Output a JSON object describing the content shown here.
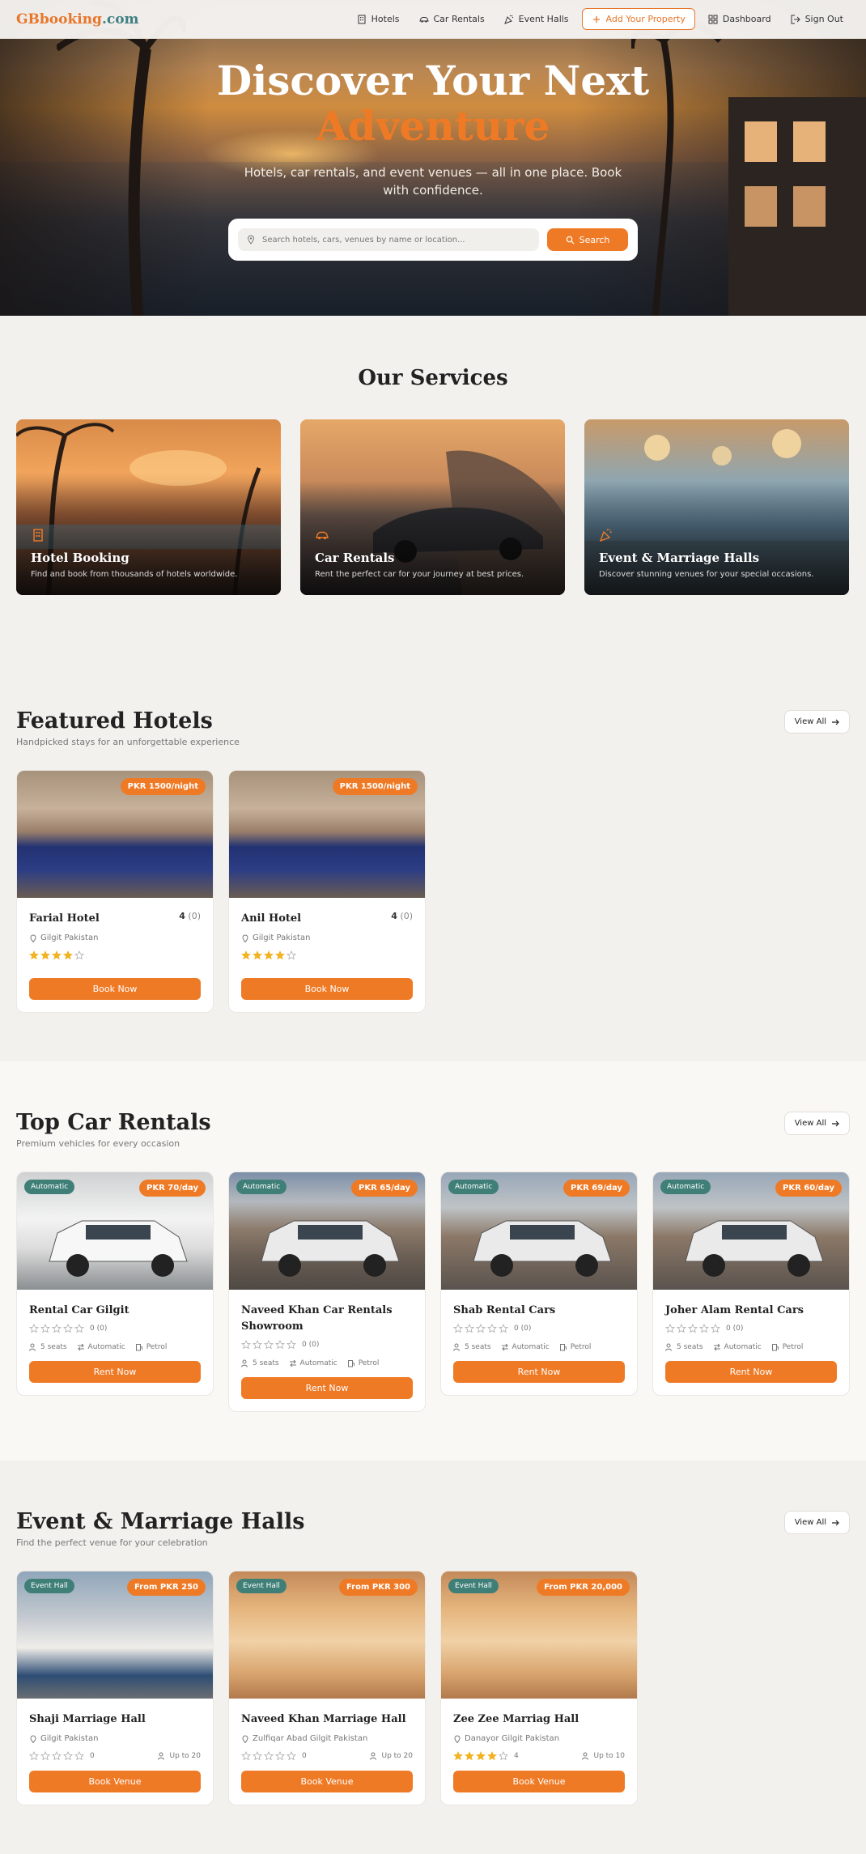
{
  "nav": {
    "logo_part1": "GBbooking",
    "logo_part2": ".com",
    "hotels": "Hotels",
    "car_rentals": "Car Rentals",
    "event_halls": "Event Halls",
    "add_property": "Add Your Property",
    "dashboard": "Dashboard",
    "sign_out": "Sign Out"
  },
  "hero": {
    "title_line1": "Discover Your Next",
    "title_line2": "Adventure",
    "subtitle": "Hotels, car rentals, and event venues — all in one place. Book with confidence.",
    "search_placeholder": "Search hotels, cars, venues by name or location...",
    "search_button": "Search"
  },
  "services": {
    "title": "Our Services",
    "items": [
      {
        "title": "Hotel Booking",
        "desc": "Find and book from thousands of hotels worldwide.",
        "icon": "building-icon"
      },
      {
        "title": "Car Rentals",
        "desc": "Rent the perfect car for your journey at best prices.",
        "icon": "car-icon"
      },
      {
        "title": "Event & Marriage Halls",
        "desc": "Discover stunning venues for your special occasions.",
        "icon": "party-icon"
      }
    ]
  },
  "hotels": {
    "title": "Featured Hotels",
    "subtitle": "Handpicked stays for an unforgettable experience",
    "view_all": "View All",
    "items": [
      {
        "name": "Farial Hotel",
        "price": "PKR 1500/night",
        "rating": "4",
        "reviews": "(0)",
        "location": "Gilgit Pakistan",
        "stars": 4,
        "button": "Book Now"
      },
      {
        "name": "Anil Hotel",
        "price": "PKR 1500/night",
        "rating": "4",
        "reviews": "(0)",
        "location": "Gilgit Pakistan",
        "stars": 4,
        "button": "Book Now"
      }
    ]
  },
  "cars": {
    "title": "Top Car Rentals",
    "subtitle": "Premium vehicles for every occasion",
    "view_all": "View All",
    "items": [
      {
        "name": "Rental Car Gilgit",
        "tag": "Automatic",
        "price": "PKR 70/day",
        "reviews": "0 (0)",
        "seats": "5 seats",
        "trans": "Automatic",
        "fuel": "Petrol",
        "button": "Rent Now"
      },
      {
        "name": "Naveed Khan Car Rentals Showroom",
        "tag": "Automatic",
        "price": "PKR 65/day",
        "reviews": "0 (0)",
        "seats": "5 seats",
        "trans": "Automatic",
        "fuel": "Petrol",
        "button": "Rent Now"
      },
      {
        "name": "Shab Rental Cars",
        "tag": "Automatic",
        "price": "PKR 69/day",
        "reviews": "0 (0)",
        "seats": "5 seats",
        "trans": "Automatic",
        "fuel": "Petrol",
        "button": "Rent Now"
      },
      {
        "name": "Joher Alam Rental Cars",
        "tag": "Automatic",
        "price": "PKR 60/day",
        "reviews": "0 (0)",
        "seats": "5 seats",
        "trans": "Automatic",
        "fuel": "Petrol",
        "button": "Rent Now"
      }
    ]
  },
  "halls": {
    "title": "Event & Marriage Halls",
    "subtitle": "Find the perfect venue for your celebration",
    "view_all": "View All",
    "items": [
      {
        "name": "Shaji Marriage Hall",
        "tag": "Event Hall",
        "price": "From PKR 250",
        "location": "Gilgit Pakistan",
        "reviews": "0",
        "capacity": "Up to 20",
        "stars": 0,
        "button": "Book Venue"
      },
      {
        "name": "Naveed Khan Marriage Hall",
        "tag": "Event Hall",
        "price": "From PKR 300",
        "location": "Zulfiqar Abad Gilgit Pakistan",
        "reviews": "0",
        "capacity": "Up to 20",
        "stars": 0,
        "button": "Book Venue"
      },
      {
        "name": "Zee Zee Marriag Hall",
        "tag": "Event Hall",
        "price": "From PKR 20,000",
        "location": "Danayor Gilgit Pakistan",
        "reviews": "4",
        "capacity": "Up to 10",
        "stars": 4,
        "button": "Book Venue"
      }
    ]
  },
  "colors": {
    "accent": "#ef7a26",
    "teal": "#3f7f77",
    "star": "#f2b323"
  }
}
